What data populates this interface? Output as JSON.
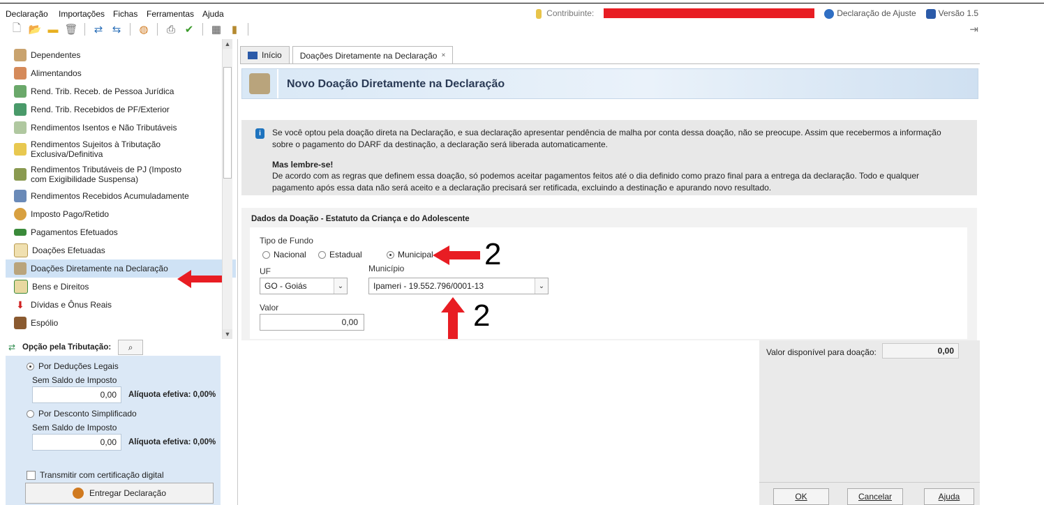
{
  "menu": [
    "Declaração",
    "Importações",
    "Fichas",
    "Ferramentas",
    "Ajuda"
  ],
  "header": {
    "contribuinte_label": "Contribuinte:",
    "declaracao": "Declaração de Ajuste",
    "versao": "Versão 1.5"
  },
  "toolbar_icons": [
    "new-icon",
    "open-icon",
    "folder-icon",
    "trash-icon",
    "transfer-icon",
    "import-icon",
    "globe-icon",
    "print-icon",
    "check-icon",
    "calculator-icon",
    "book-icon"
  ],
  "sidebar": {
    "items": [
      {
        "label": "Dependentes",
        "icon": "dependents-icon"
      },
      {
        "label": "Alimentandos",
        "icon": "people-icon"
      },
      {
        "label": "Rend. Trib. Receb. de Pessoa Jurídica",
        "icon": "income-pj-icon"
      },
      {
        "label": "Rend. Trib. Recebidos de PF/Exterior",
        "icon": "income-pf-icon"
      },
      {
        "label": "Rendimentos Isentos e Não Tributáveis",
        "icon": "exempt-icon"
      },
      {
        "label": "Rendimentos Sujeitos à Tributação Exclusiva/Definitiva",
        "icon": "exclusive-icon"
      },
      {
        "label": "Rendimentos Tributáveis de PJ (Imposto com Exigibilidade Suspensa)",
        "icon": "suspended-icon"
      },
      {
        "label": "Rendimentos Recebidos Acumuladamente",
        "icon": "accumulated-icon"
      },
      {
        "label": "Imposto Pago/Retido",
        "icon": "tax-paid-icon"
      },
      {
        "label": "Pagamentos Efetuados",
        "icon": "payment-card-icon"
      },
      {
        "label": "Doações Efetuadas",
        "icon": "donation-icon"
      },
      {
        "label": "Doações Diretamente na Declaração",
        "icon": "direct-donation-icon"
      },
      {
        "label": "Bens e Direitos",
        "icon": "assets-icon"
      },
      {
        "label": "Dívidas e Ônus Reais",
        "icon": "debts-icon"
      },
      {
        "label": "Espólio",
        "icon": "estate-icon"
      }
    ]
  },
  "opcao": {
    "title": "Opção pela Tributação:",
    "deducoes_label": "Por Deduções Legais",
    "deducoes_saldo": "Sem Saldo de Imposto",
    "deducoes_valor": "0,00",
    "deducoes_aliquota": "Alíquota efetiva: 0,00%",
    "simplificado_label": "Por Desconto Simplificado",
    "simplificado_saldo": "Sem Saldo de Imposto",
    "simplificado_valor": "0,00",
    "simplificado_aliquota": "Alíquota efetiva: 0,00%",
    "transmitir": "Transmitir com certificação digital",
    "entregar": "Entregar Declaração"
  },
  "tabs": [
    {
      "label": "Início"
    },
    {
      "label": "Doações Diretamente na Declaração",
      "close": "×"
    }
  ],
  "main": {
    "title": "Novo Doação Diretamente na Declaração",
    "info_p1": "Se você optou pela doação direta na Declaração, e sua declaração apresentar pendência de malha por conta dessa doação, não se preocupe. Assim que recebermos a informação sobre o pagamento do DARF da destinação, a declaração será liberada automaticamente.",
    "info_bold": "Mas lembre-se!",
    "info_p2": "De acordo com as regras que definem essa doação, só podemos aceitar pagamentos feitos até o dia definido como prazo final para a entrega da declaração. Todo e qualquer pagamento após essa data não será aceito e a declaração precisará ser retificada, excluindo a destinação e apurando novo resultado.",
    "section_title": "Dados da Doação - Estatuto da Criança e do Adolescente",
    "tipo_label": "Tipo de Fundo",
    "opt_nacional": "Nacional",
    "opt_estadual": "Estadual",
    "opt_municipal": "Municipal",
    "uf_label": "UF",
    "uf_value": "GO - Goiás",
    "municipio_label": "Município",
    "municipio_value": "Ipameri - 19.552.796/0001-13",
    "valor_label": "Valor",
    "valor_value": "0,00",
    "anno1": "2",
    "anno2": "2",
    "vd_label": "Valor disponível para doação:",
    "vd_value": "0,00",
    "ok": "OK",
    "cancelar": "Cancelar",
    "ajuda": "Ajuda"
  },
  "colors": {
    "accent_red": "#e81d23",
    "selection": "#cfe2f5",
    "panel_blue": "#dbe8f6"
  }
}
